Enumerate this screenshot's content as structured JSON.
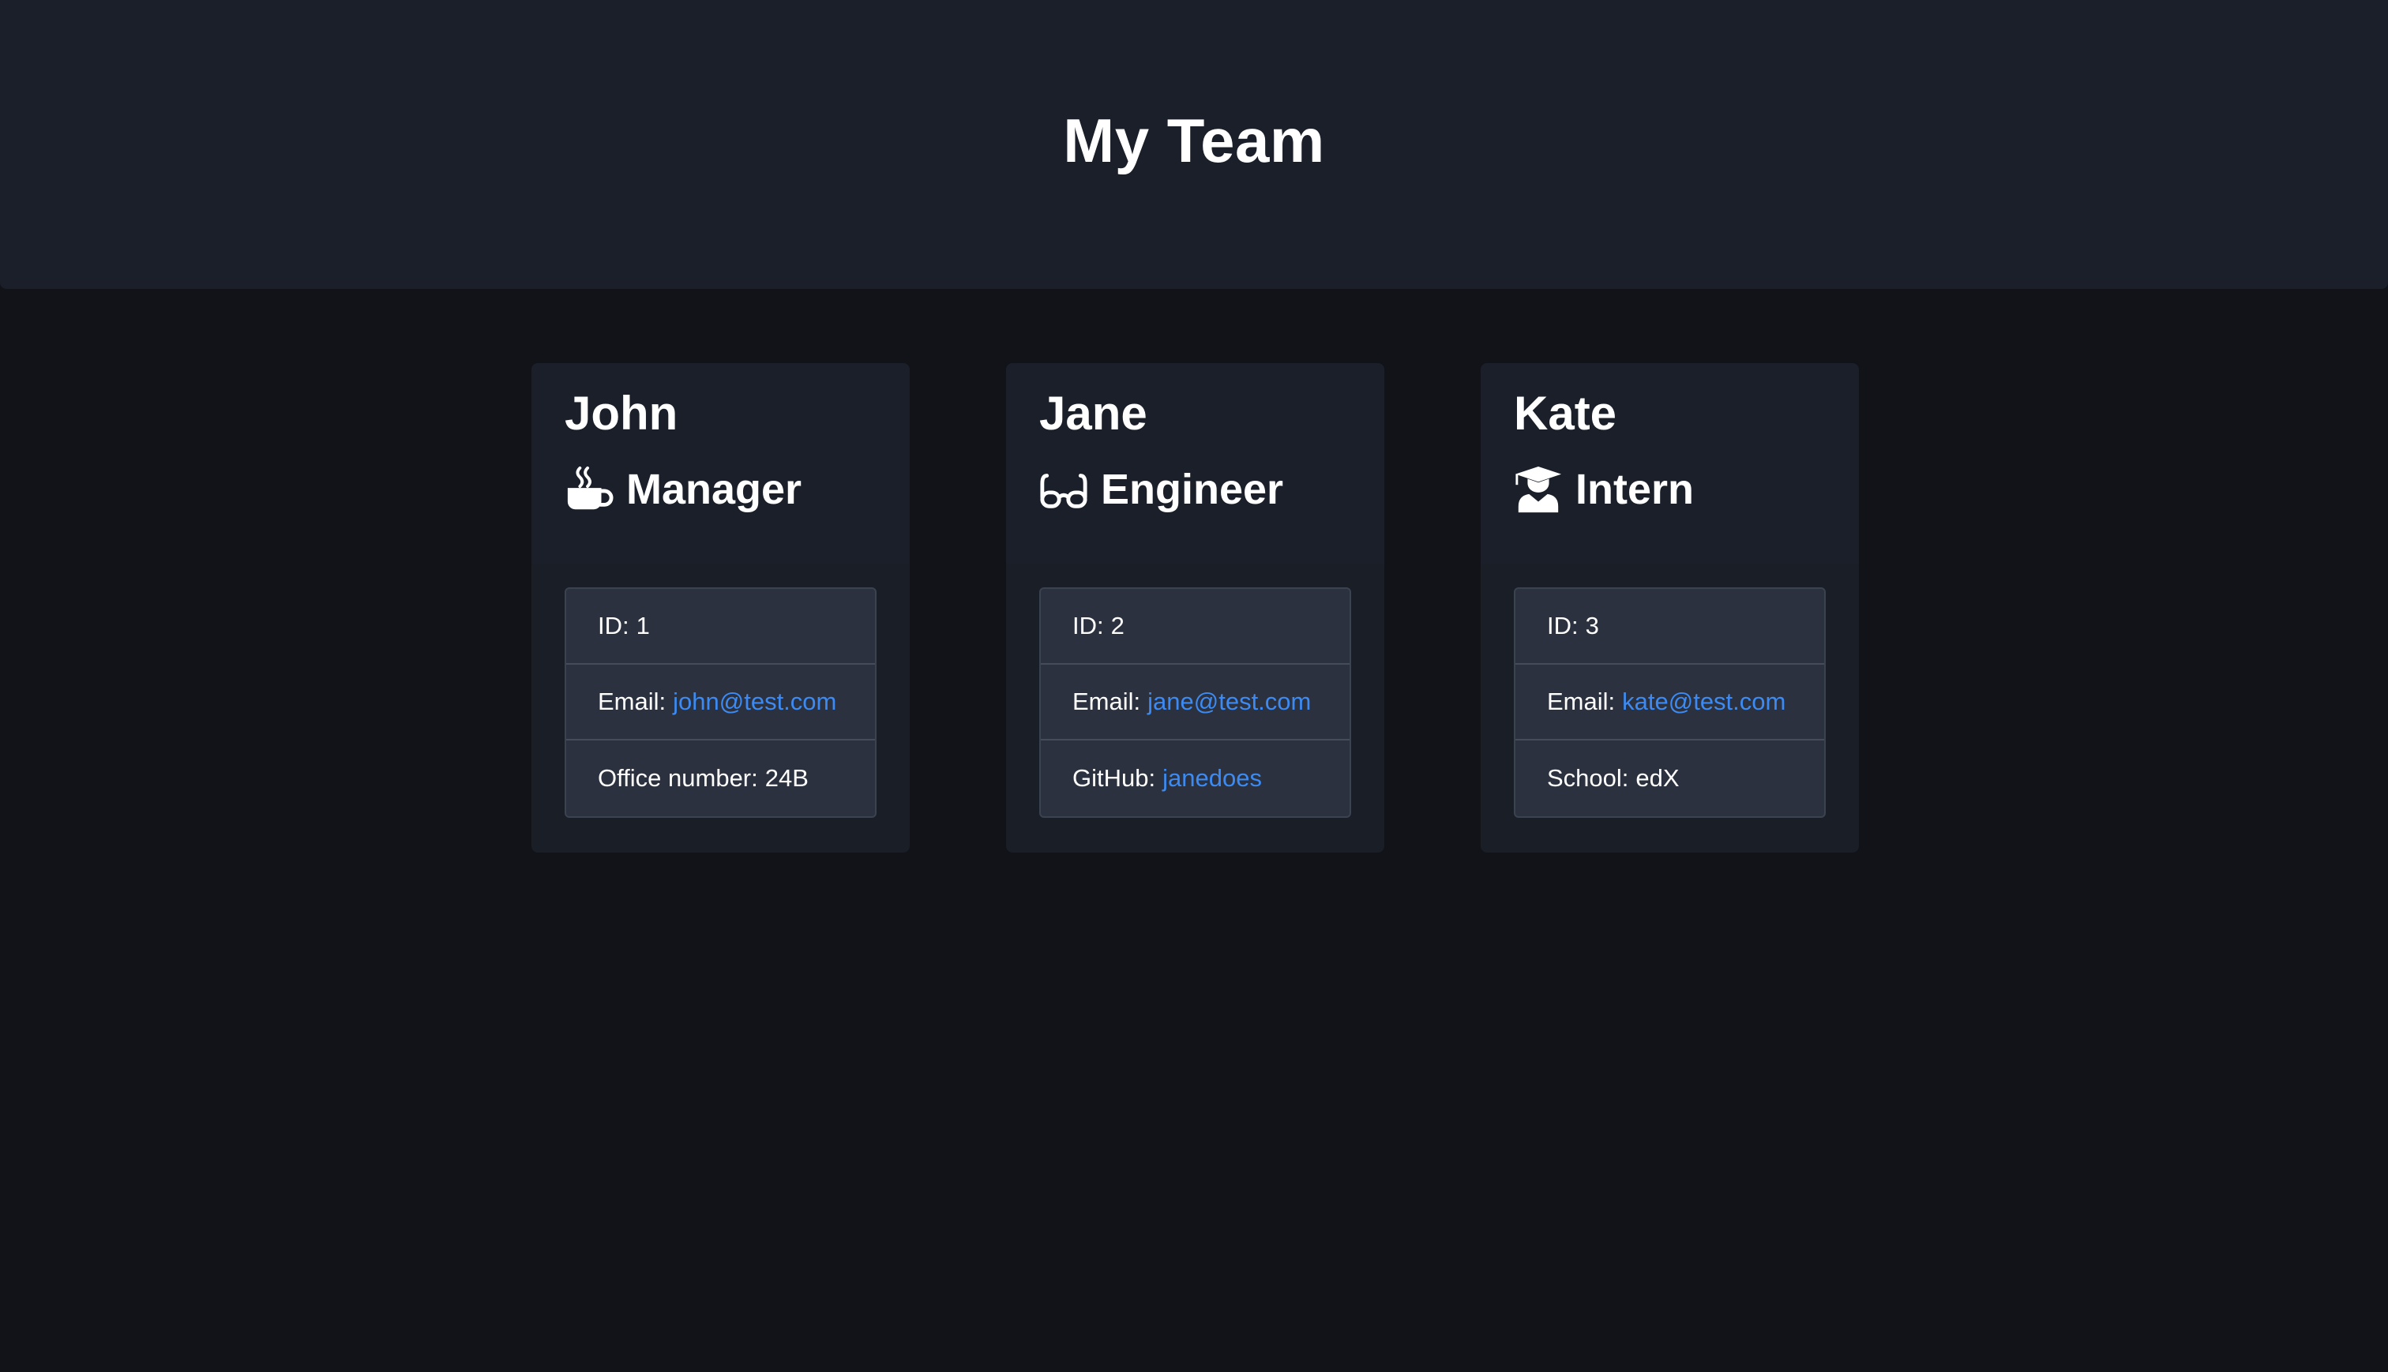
{
  "header": {
    "title": "My Team"
  },
  "team": [
    {
      "name": "John",
      "role": "Manager",
      "icon": "coffee-icon",
      "id_label": "ID:",
      "id": "1",
      "email_label": "Email:",
      "email": "john@test.com",
      "extra_label": "Office number:",
      "extra_value": "24B"
    },
    {
      "name": "Jane",
      "role": "Engineer",
      "icon": "glasses-icon",
      "id_label": "ID:",
      "id": "2",
      "email_label": "Email:",
      "email": "jane@test.com",
      "extra_label": "GitHub:",
      "extra_value": "janedoes"
    },
    {
      "name": "Kate",
      "role": "Intern",
      "icon": "graduate-icon",
      "id_label": "ID:",
      "id": "3",
      "email_label": "Email:",
      "email": "kate@test.com",
      "extra_label": "School:",
      "extra_value": "edX"
    }
  ],
  "colors": {
    "background": "#111318",
    "header_bg": "#1a1f29",
    "list_bg": "#2b313e",
    "link": "#3d8bf2",
    "text": "#ffffff"
  }
}
